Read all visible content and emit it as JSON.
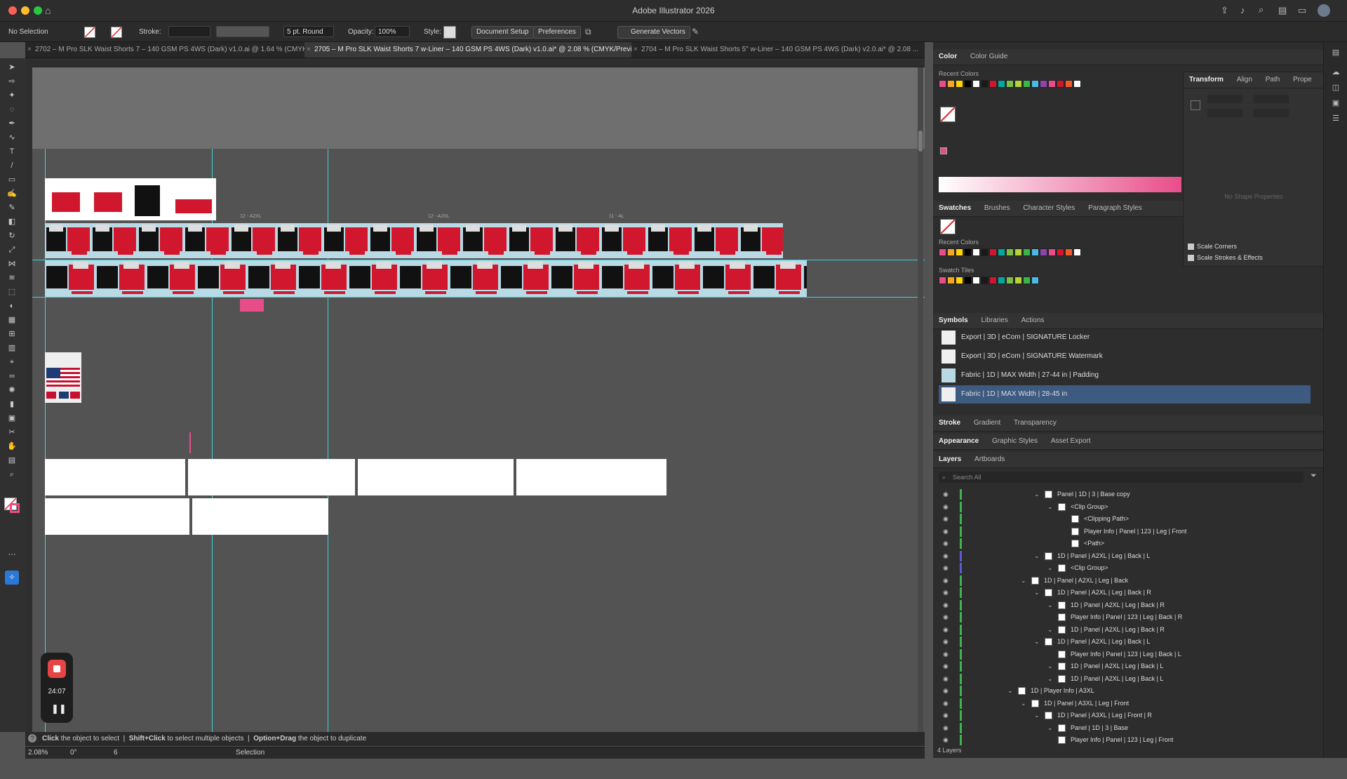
{
  "app": {
    "title": "Adobe Illustrator 2026"
  },
  "controlbar": {
    "selection": "No Selection",
    "stroke_label": "Stroke:",
    "brush": "5 pt. Round",
    "opacity_label": "Opacity:",
    "opacity_value": "100%",
    "style_label": "Style:",
    "document_setup": "Document Setup",
    "preferences": "Preferences",
    "generate_vectors": "Generate Vectors"
  },
  "tabs": [
    {
      "label": "2702 – M Pro SLK Waist Shorts 7 – 140 GSM PS 4WS (Dark) v1.0.ai @ 1.64 % (CMYK/Pr..."
    },
    {
      "label": "2705 – M Pro SLK Waist Shorts 7 w-Liner – 140 GSM PS 4WS (Dark) v1.0.ai* @ 2.08 % (CMYK/Preview)"
    },
    {
      "label": "2704 – M Pro SLK Waist Shorts 5\" w-Liner – 140 GSM PS 4WS (Dark) v2.0.ai* @ 2.08 ..."
    }
  ],
  "status": {
    "hint1_bold": "Click",
    "hint1": "the object to select",
    "hint2_bold": "Shift+Click",
    "hint2": "to select multiple objects",
    "hint3_bold": "Option+Drag",
    "hint3": "the object to duplicate",
    "zoom": "2.08%",
    "rotation": "0°",
    "artboard": "6",
    "tool": "Selection"
  },
  "recorder": {
    "time": "24:07"
  },
  "color_panel": {
    "tabs": [
      "Color",
      "Color Guide"
    ],
    "recent_colors_label": "Recent Colors",
    "recent": [
      "#e84d8a",
      "#f5a623",
      "#ffd400",
      "#000000",
      "#ffffff",
      "#1a1a1a",
      "#d1172d",
      "#00a99d",
      "#7ac143",
      "#b5d334",
      "#39b54a",
      "#4cb8e6",
      "#8e44ad",
      "#e84d8a",
      "#d1172d",
      "#f05a28",
      "#ffffff"
    ]
  },
  "swatches_panel": {
    "tabs": [
      "Swatches",
      "Brushes",
      "Character Styles",
      "Paragraph Styles"
    ],
    "recent_colors_label": "Recent Colors",
    "swatch_tiles_label": "Swatch Tiles"
  },
  "symbols_panel": {
    "tabs": [
      "Symbols",
      "Libraries",
      "Actions"
    ],
    "items": [
      {
        "name": "Export | 3D | eCom | SIGNATURE Locker"
      },
      {
        "name": "Export | 3D | eCom | SIGNATURE Watermark"
      },
      {
        "name": "Fabric | 1D | MAX Width | 27-44 in | Padding"
      },
      {
        "name": "Fabric | 1D | MAX Width | 28-45 in"
      }
    ]
  },
  "stroke_panel": {
    "tabs": [
      "Stroke",
      "Gradient",
      "Transparency"
    ]
  },
  "appearance_panel": {
    "tabs": [
      "Appearance",
      "Graphic Styles",
      "Asset Export"
    ]
  },
  "transform_panel": {
    "tabs": [
      "Transform",
      "Align",
      "Path",
      "Prope"
    ],
    "no_shape": "No Shape Properties",
    "scale_corners": "Scale Corners",
    "scale_strokes": "Scale Strokes & Effects"
  },
  "layers_panel": {
    "tabs": [
      "Layers",
      "Artboards"
    ],
    "search_placeholder": "Search All",
    "rows": [
      {
        "name": "Panel | 1D | 3 | Base copy",
        "indent": 1
      },
      {
        "name": "<Clip Group>",
        "indent": 2
      },
      {
        "name": "<Clipping Path>",
        "indent": 3
      },
      {
        "name": "Player Info | Panel | 123 | Leg | Front",
        "indent": 3
      },
      {
        "name": "<Path>",
        "indent": 3
      },
      {
        "name": "1D | Panel | A2XL | Leg | Back | L",
        "indent": 1
      },
      {
        "name": "<Clip Group>",
        "indent": 2
      },
      {
        "name": "1D | Panel | A2XL | Leg | Back",
        "indent": 0
      },
      {
        "name": "1D | Panel | A2XL | Leg | Back | R",
        "indent": 1
      },
      {
        "name": "1D | Panel | A2XL | Leg | Back | R",
        "indent": 2
      },
      {
        "name": "Player Info | Panel | 123 | Leg | Back | R",
        "indent": 2
      },
      {
        "name": "1D | Panel | A2XL | Leg | Back | R",
        "indent": 2
      },
      {
        "name": "1D | Panel | A2XL | Leg | Back | L",
        "indent": 1
      },
      {
        "name": "Player Info | Panel | 123 | Leg | Back | L",
        "indent": 2
      },
      {
        "name": "1D | Panel | A2XL | Leg | Back | L",
        "indent": 2
      },
      {
        "name": "1D | Panel | A2XL | Leg | Back | L",
        "indent": 2
      },
      {
        "name": "1D | Player Info | A3XL",
        "indent": -1
      },
      {
        "name": "1D | Panel | A3XL | Leg | Front",
        "indent": 0
      },
      {
        "name": "1D | Panel | A3XL | Leg | Front | R",
        "indent": 1
      },
      {
        "name": "Panel | 1D | 3 | Base",
        "indent": 2
      },
      {
        "name": "Player Info | Panel | 123 | Leg | Front",
        "indent": 2
      }
    ],
    "count": "4 Layers"
  },
  "canvas": {
    "artboard_labels": [
      "12 - A2XL",
      "12 - A2XL",
      "11 - AL"
    ]
  }
}
